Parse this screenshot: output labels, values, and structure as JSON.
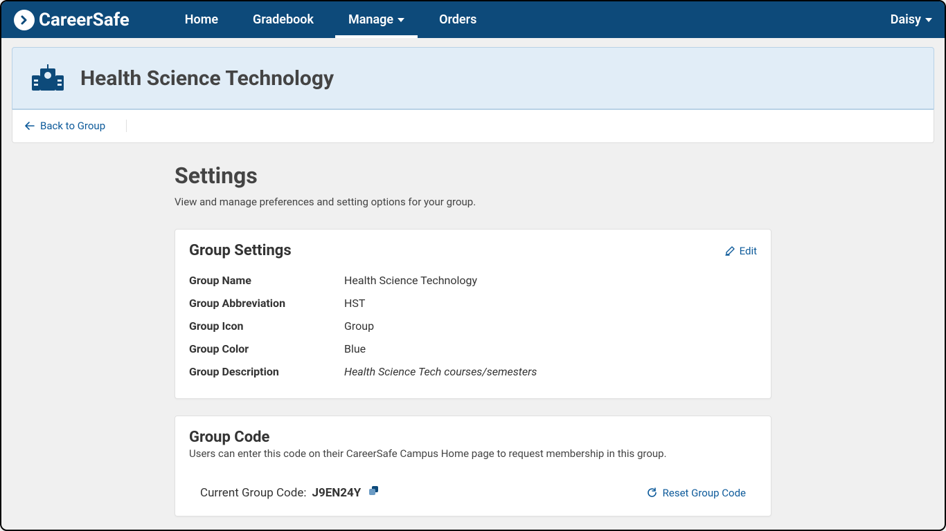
{
  "brand": {
    "name": "CareerSafe"
  },
  "nav": {
    "items": [
      {
        "label": "Home"
      },
      {
        "label": "Gradebook"
      },
      {
        "label": "Manage",
        "active": true,
        "dropdown": true
      },
      {
        "label": "Orders"
      }
    ],
    "user": "Daisy"
  },
  "banner": {
    "title": "Health Science Technology"
  },
  "back_link": "Back to Group",
  "section": {
    "title": "Settings",
    "subtitle": "View and manage preferences and setting options for your group."
  },
  "group_settings": {
    "card_title": "Group Settings",
    "edit_label": "Edit",
    "rows": {
      "name_label": "Group Name",
      "name_value": "Health Science Technology",
      "abbr_label": "Group Abbreviation",
      "abbr_value": "HST",
      "icon_label": "Group Icon",
      "icon_value": "Group",
      "color_label": "Group Color",
      "color_value": "Blue",
      "desc_label": "Group Description",
      "desc_value": "Health Science Tech courses/semesters"
    }
  },
  "group_code": {
    "card_title": "Group Code",
    "subtext": "Users can enter this code on their CareerSafe Campus Home page to request membership in this group.",
    "current_label": "Current Group Code:",
    "code": "J9EN24Y",
    "reset_label": "Reset Group Code"
  }
}
